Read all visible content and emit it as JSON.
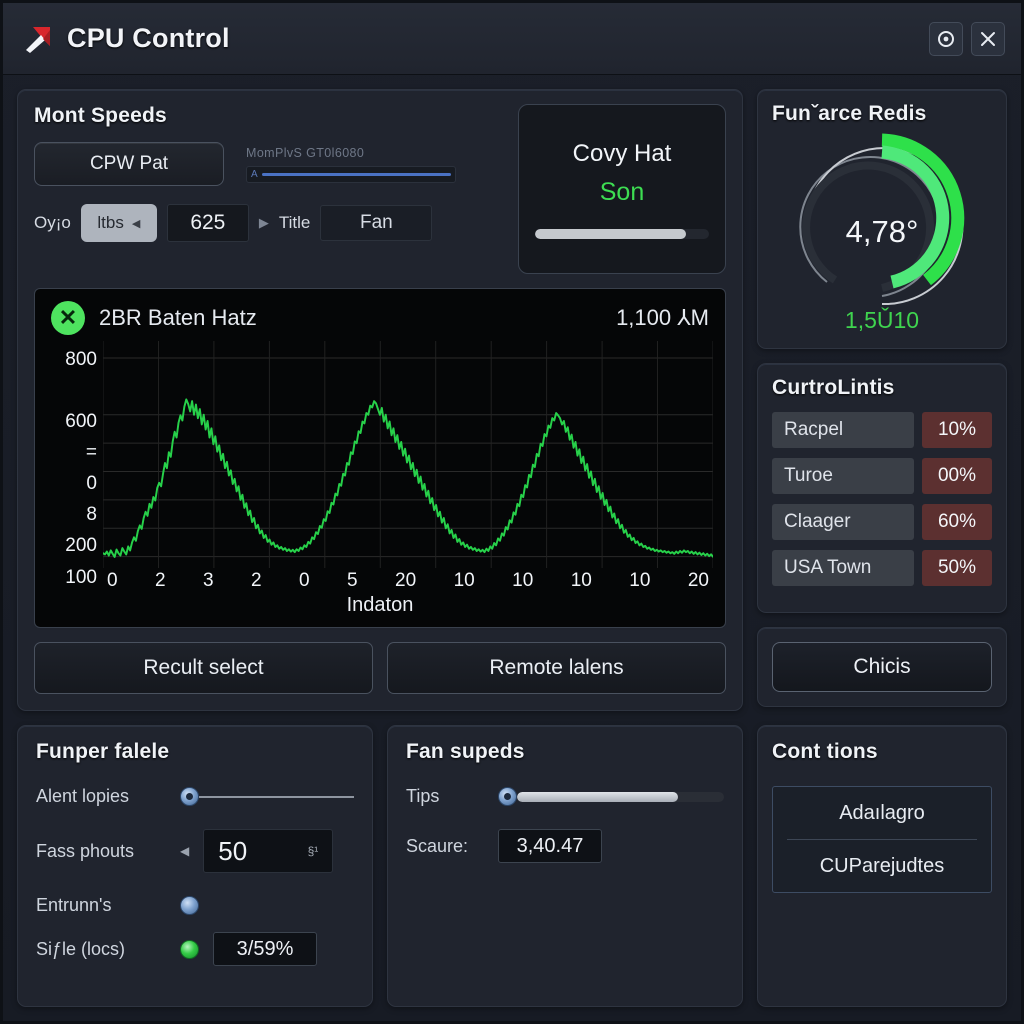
{
  "window": {
    "title": "CPU Control",
    "logo_icon": "red-arrow-logo",
    "settings_icon": "gear-icon",
    "close_icon": "close-icon"
  },
  "monitor": {
    "title": "Mont Speeds",
    "profile_button": "CPW Pat",
    "progress_label": "MomPlvS GT0l6080",
    "progress_prefix": "A",
    "progress_value": 92,
    "row": {
      "label": "Oy¡o",
      "chip": "ltbs",
      "chip_caret": "◀",
      "number": "625",
      "caret": "▶",
      "title_label": "Title",
      "title_value": "Fan"
    },
    "tile": {
      "title": "Covy Hat",
      "status": "Son",
      "bar_value": 87
    }
  },
  "chart_data": {
    "type": "line",
    "title": "2BR Baten Hatz",
    "value_readout": "1,100 ⅄M",
    "status_icon": "close-circle-icon",
    "xlabel": "Indaton",
    "ylabel": "",
    "grid": true,
    "legend": "none",
    "ytick_labels": [
      "800",
      "600",
      "=",
      "0",
      "8",
      "200",
      "100"
    ],
    "yticks": [
      800,
      600,
      500,
      400,
      300,
      200,
      100
    ],
    "ylim": [
      60,
      860
    ],
    "xtick_labels": [
      "0",
      "2",
      "3",
      "2",
      "0",
      "5",
      "20",
      "10",
      "10",
      "10",
      "10",
      "20"
    ],
    "series": [
      {
        "name": "Baten Hatz",
        "color": "#27d14a",
        "values": [
          112,
          108,
          118,
          104,
          122,
          110,
          99,
          125,
          112,
          104,
          130,
          118,
          108,
          136,
          122,
          150,
          168,
          156,
          190,
          210,
          198,
          236,
          258,
          244,
          286,
          272,
          310,
          298,
          342,
          360,
          348,
          392,
          430,
          412,
          468,
          452,
          506,
          540,
          520,
          572,
          598,
          580,
          628,
          654,
          638,
          612,
          648,
          600,
          636,
          588,
          620,
          566,
          600,
          548,
          578,
          520,
          552,
          496,
          524,
          470,
          492,
          440,
          462,
          412,
          434,
          386,
          404,
          356,
          374,
          330,
          348,
          300,
          318,
          272,
          288,
          246,
          262,
          222,
          236,
          200,
          212,
          182,
          192,
          166,
          176,
          152,
          160,
          142,
          150,
          134,
          140,
          128,
          134,
          124,
          130,
          120,
          126,
          118,
          124,
          116,
          126,
          120,
          132,
          126,
          140,
          134,
          152,
          146,
          168,
          162,
          186,
          180,
          208,
          202,
          232,
          226,
          260,
          254,
          290,
          284,
          322,
          316,
          356,
          350,
          392,
          386,
          430,
          424,
          468,
          462,
          506,
          500,
          542,
          536,
          576,
          570,
          606,
          600,
          632,
          626,
          648,
          640,
          620,
          600,
          624,
          576,
          600,
          552,
          576,
          528,
          552,
          504,
          528,
          480,
          504,
          456,
          480,
          432,
          456,
          408,
          430,
          384,
          406,
          360,
          382,
          336,
          356,
          312,
          332,
          288,
          306,
          264,
          282,
          242,
          258,
          220,
          236,
          200,
          214,
          182,
          194,
          166,
          178,
          152,
          162,
          142,
          150,
          134,
          142,
          128,
          134,
          124,
          130,
          120,
          126,
          118,
          124,
          116,
          128,
          120,
          136,
          128,
          148,
          140,
          164,
          156,
          182,
          174,
          204,
          196,
          228,
          220,
          256,
          248,
          286,
          278,
          318,
          310,
          352,
          344,
          388,
          380,
          424,
          416,
          462,
          454,
          498,
          490,
          532,
          524,
          562,
          554,
          588,
          580,
          606,
          598,
          588,
          566,
          578,
          540,
          556,
          512,
          530,
          484,
          504,
          456,
          478,
          430,
          452,
          404,
          426,
          378,
          400,
          352,
          374,
          328,
          348,
          304,
          324,
          282,
          300,
          260,
          276,
          238,
          252,
          218,
          232,
          200,
          212,
          184,
          194,
          170,
          178,
          158,
          166,
          148,
          154,
          140,
          146,
          134,
          138,
          128,
          132,
          124,
          128,
          120,
          124,
          118,
          122,
          116,
          120,
          114,
          118,
          112,
          116,
          110,
          118,
          112,
          120,
          114,
          122,
          116,
          120,
          112,
          118,
          110,
          116,
          108,
          114,
          106,
          112,
          104,
          110,
          102,
          108,
          100
        ]
      }
    ]
  },
  "actions": {
    "primary": "Recult select",
    "secondary": "Remote lalens"
  },
  "gauge": {
    "title": "Funˇarce Redis",
    "center_value": "4,78°",
    "sub_value": "1,5Ǔ10",
    "outer_pct": 66,
    "inner_pct": 58,
    "outer_color": "#2ee04a",
    "inner_color": "#4fe87a"
  },
  "limits": {
    "title": "CurtroLintis",
    "rows": [
      {
        "name": "Racpel",
        "value": "10%"
      },
      {
        "name": "Turoe",
        "value": "00%"
      },
      {
        "name": "Claager",
        "value": "60%"
      },
      {
        "name": "USA Town",
        "value": "50%"
      }
    ],
    "badge_color": "#5c3030"
  },
  "chicis": {
    "label": "Chicis"
  },
  "funper": {
    "title": "Funper falele",
    "slider_label": "Alent lopies",
    "slider_value": 2,
    "number_label": "Fass phouts",
    "number_value": "50",
    "number_unit": "§¹",
    "toggle_label": "Entrunn's",
    "toggle_icon": "blue-dot-icon",
    "status_label": "Siƒle (locs)",
    "status_icon": "green-check-icon",
    "status_value": "3/59%"
  },
  "fanspeeds": {
    "title": "Fan supeds",
    "slider_label": "Tips",
    "slider_value": 78,
    "score_label": "Scaure:",
    "score_value": "3,40.47"
  },
  "conttions": {
    "title": "Cont tions",
    "options": [
      "Adaılagro",
      "CUParejudtes"
    ]
  }
}
